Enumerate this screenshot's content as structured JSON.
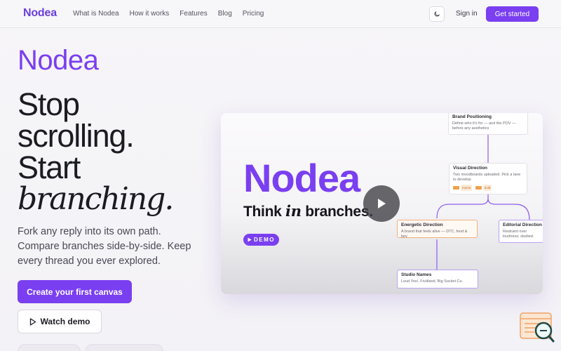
{
  "nav": {
    "logo": "Nodea",
    "links": [
      "What is Nodea",
      "How it works",
      "Features",
      "Blog",
      "Pricing"
    ],
    "theme_icon": "moon-icon",
    "signin": "Sign in",
    "get_started": "Get started"
  },
  "hero": {
    "brand": "Nodea",
    "headline": [
      "Stop",
      "scrolling.",
      "Start"
    ],
    "headline_italic": "branching.",
    "subtext": "Fork any reply into its own path. Compare branches side-by-side. Keep every thread you ever explored.",
    "cta_primary": "Create your first canvas",
    "cta_secondary": "Watch demo",
    "cta_secondary_icon": "play-icon"
  },
  "video": {
    "brand": "Nodea",
    "tag_before": "Think ",
    "tag_italic": "in",
    "tag_after": " branches.",
    "demo_label": "DEMO",
    "play_icon": "play-icon",
    "nodes": {
      "brand_positioning": {
        "title": "Brand Positioning",
        "body": "Define who it's for — and the POV — before any aesthetics"
      },
      "visual_direction": {
        "title": "Visual Direction",
        "body": "Two moodboards uploaded. Pick a lane to develop.",
        "tags": [
          "moms",
          "bold"
        ]
      },
      "energetic_direction": {
        "title": "Energetic Direction",
        "body": "A brand that feels alive — DTC, food & bev"
      },
      "editorial_direction": {
        "title": "Editorial Direction",
        "body": "Restraint over loudness; studied."
      },
      "studio_names": {
        "title": "Studio Names",
        "body": "Loud Yes!, Fruitland, Big Socket Co."
      }
    }
  },
  "colors": {
    "accent": "#7a3ff0",
    "text": "#1b1b22",
    "muted": "#4a4853",
    "node_orange": "#f1b07a"
  }
}
